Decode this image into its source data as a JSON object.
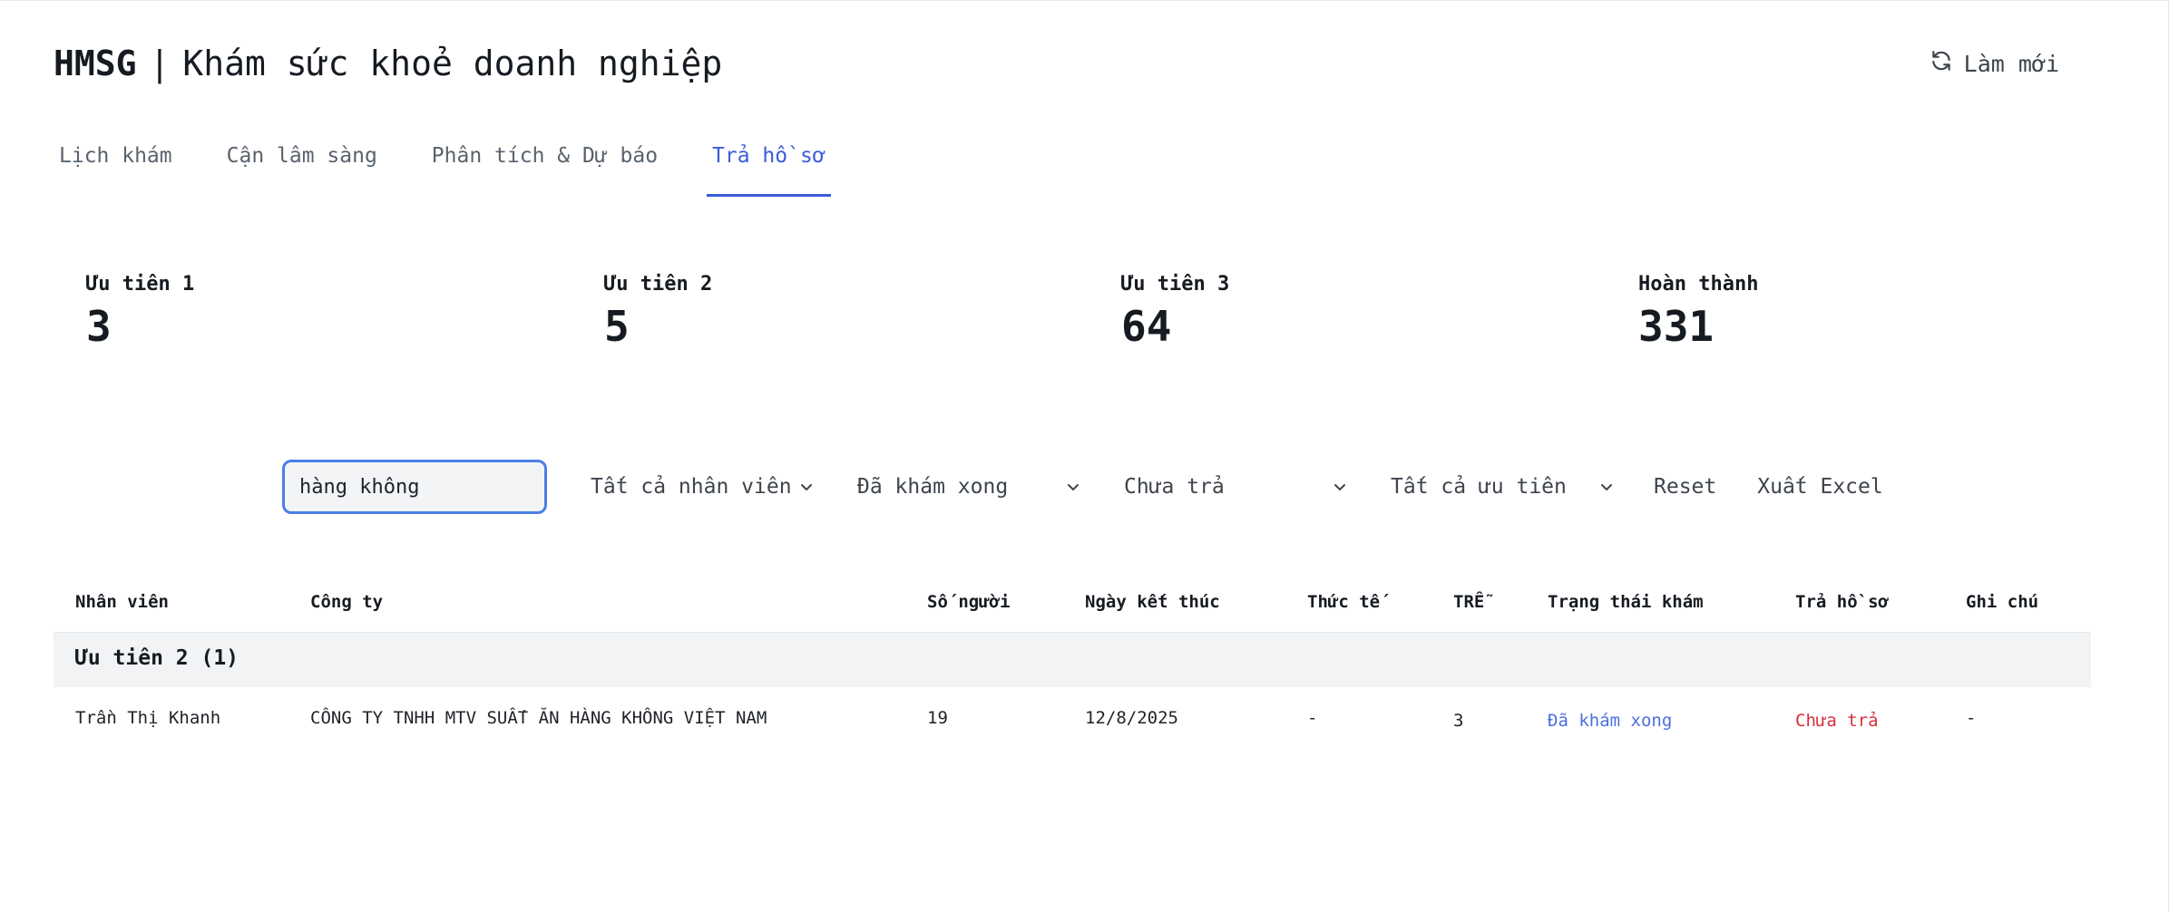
{
  "header": {
    "brand": "HMSG",
    "separator": "|",
    "title": "Khám sức khoẻ doanh nghiệp",
    "refresh_label": "Làm mới",
    "refresh_icon": "refresh-icon"
  },
  "tabs": [
    {
      "label": "Lịch khám",
      "active": false
    },
    {
      "label": "Cận lâm sàng",
      "active": false
    },
    {
      "label": "Phân tích & Dự báo",
      "active": false
    },
    {
      "label": "Trả hồ sơ",
      "active": true
    }
  ],
  "stats": [
    {
      "label": "Ưu tiên 1",
      "value": "3"
    },
    {
      "label": "Ưu tiên 2",
      "value": "5"
    },
    {
      "label": "Ưu tiên 3",
      "value": "64"
    },
    {
      "label": "Hoàn thành",
      "value": "331"
    }
  ],
  "filters": {
    "search_value": "hàng không",
    "staff_select": "Tất cả nhân viên",
    "exam_status_select": "Đã khám xong",
    "return_status_select": "Chưa trả",
    "priority_select": "Tất cả ưu tiên",
    "reset_label": "Reset",
    "export_label": "Xuất Excel"
  },
  "table": {
    "headers": [
      "Nhân viên",
      "Công ty",
      "Số người",
      "Ngày kết thúc",
      "Thức tế",
      "TRỄ",
      "Trạng thái khám",
      "Trả hồ sơ",
      "Ghi chú"
    ],
    "groups": [
      {
        "label": "Ưu tiên 2 (1)",
        "rows": [
          {
            "staff": "Trần Thị Khanh",
            "company": "CÔNG TY TNHH MTV SUẤT ĂN HÀNG KHÔNG VIỆT NAM",
            "people": "19",
            "end_date": "12/8/2025",
            "actual": "-",
            "late": "3",
            "exam_status": "Đã khám xong",
            "return_status": "Chưa trả",
            "note": "-"
          }
        ]
      }
    ]
  },
  "colors": {
    "accent": "#3b5bdb",
    "status_done": "#4c6fe0",
    "status_pending": "#d6303a",
    "group_bg": "#f2f3f5"
  }
}
